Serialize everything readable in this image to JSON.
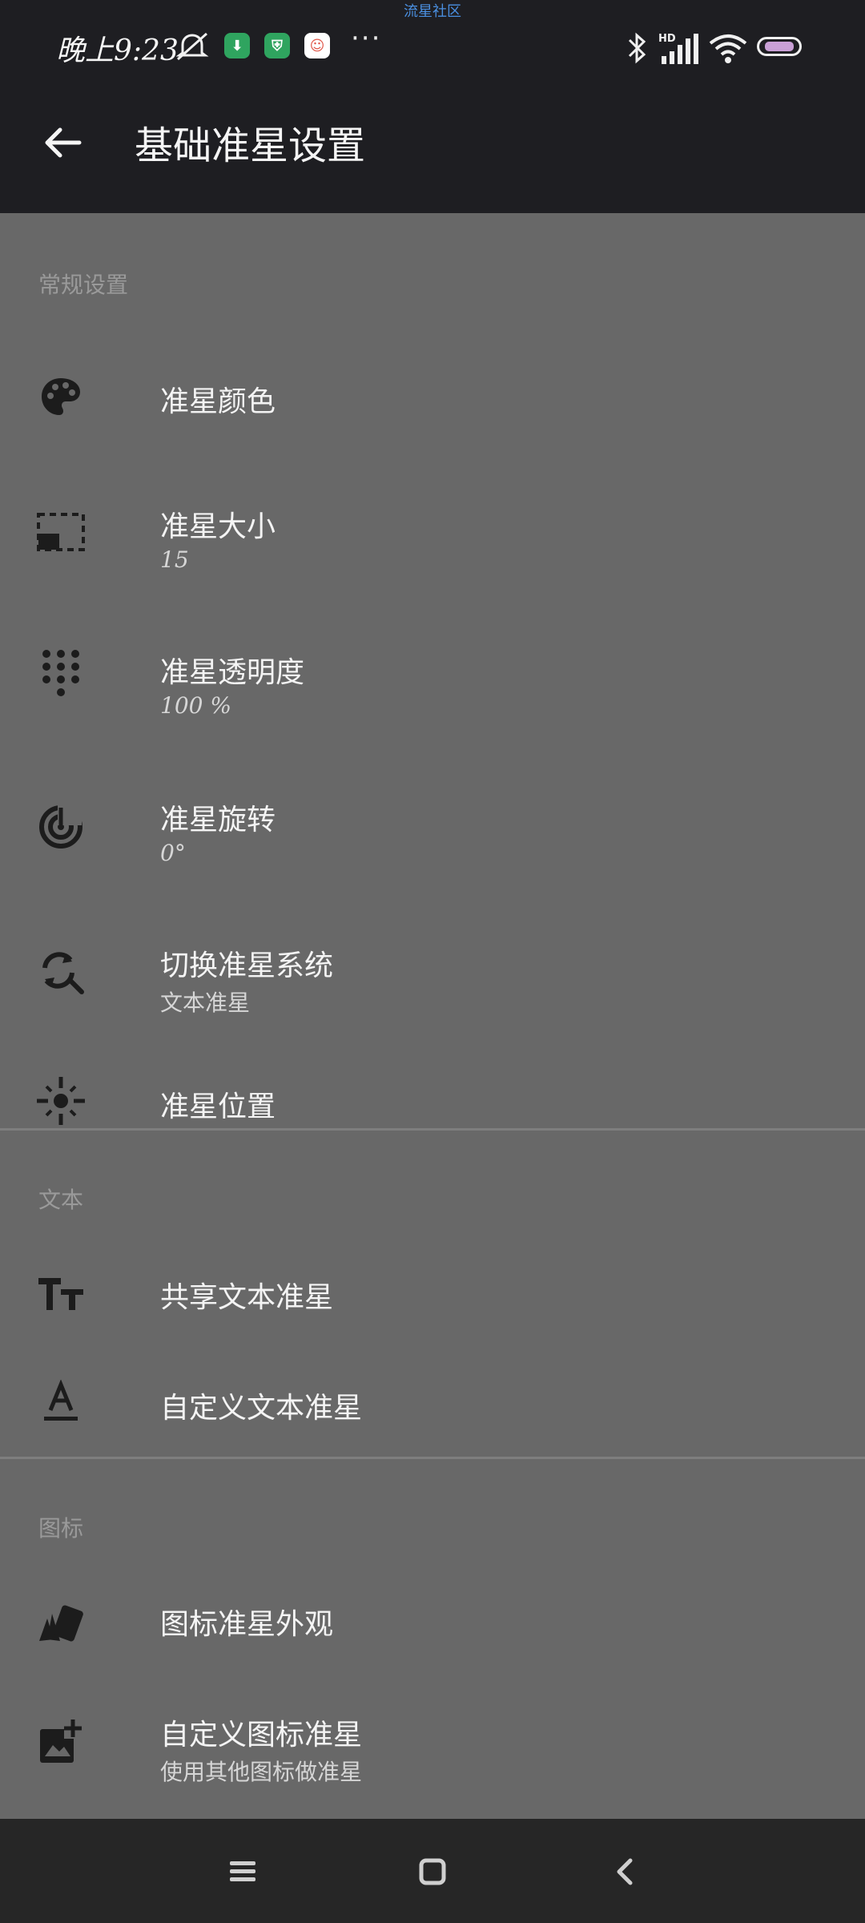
{
  "status_bar": {
    "community_label": "流星社区",
    "time": "晚上9:23",
    "more": "···",
    "network": "HD"
  },
  "app_bar": {
    "title": "基础准星设置"
  },
  "sections": [
    {
      "header": "常规设置",
      "items": [
        {
          "title": "准星颜色",
          "subtitle": "",
          "icon": "palette-icon"
        },
        {
          "title": "准星大小",
          "subtitle": "15",
          "icon": "resize-icon"
        },
        {
          "title": "准星透明度",
          "subtitle": "100 %",
          "icon": "dots-icon"
        },
        {
          "title": "准星旋转",
          "subtitle": "0°",
          "icon": "rotation-icon"
        },
        {
          "title": "切换准星系统",
          "subtitle": "文本准星",
          "icon": "sync-icon"
        },
        {
          "title": "准星位置",
          "subtitle": "",
          "icon": "position-icon"
        }
      ]
    },
    {
      "header": "文本",
      "items": [
        {
          "title": "共享文本准星",
          "subtitle": "",
          "icon": "text-size-icon"
        },
        {
          "title": "自定义文本准星",
          "subtitle": "",
          "icon": "text-format-icon"
        }
      ]
    },
    {
      "header": "图标",
      "items": [
        {
          "title": "图标准星外观",
          "subtitle": "",
          "icon": "cards-icon"
        },
        {
          "title": "自定义图标准星",
          "subtitle": "使用其他图标做准星",
          "icon": "add-image-icon"
        }
      ]
    }
  ],
  "colors": {
    "topbar": "#1e1e22",
    "background": "#686868",
    "navbar": "#262626",
    "section_header": "#9a9a9a"
  }
}
